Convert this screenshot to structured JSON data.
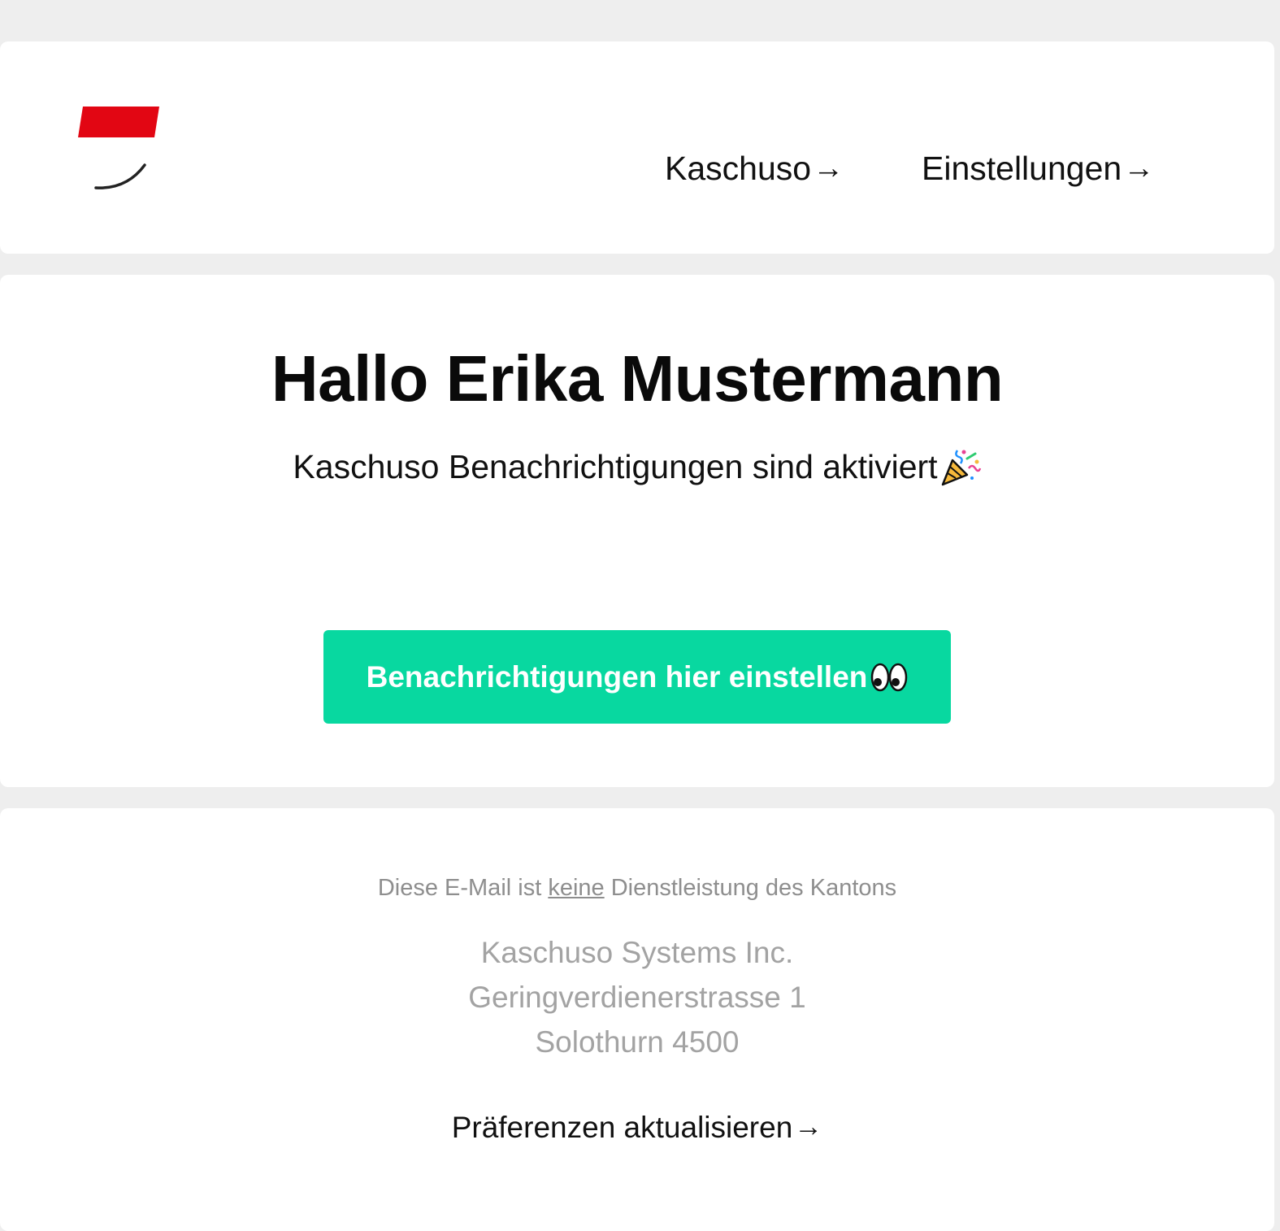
{
  "header": {
    "nav_kaschuso": "Kaschuso",
    "nav_einstellungen": "Einstellungen",
    "arrow": "→"
  },
  "main": {
    "title": "Hallo Erika Mustermann",
    "subtitle": "Kaschuso Benachrichtigungen sind aktiviert",
    "subtitle_icon": "party-popper-icon",
    "cta_label": "Benachrichtigungen hier einstellen",
    "cta_icon": "eyes-icon"
  },
  "footer": {
    "disclaimer_before": "Diese E-Mail ist ",
    "disclaimer_emphasis": "keine",
    "disclaimer_after": " Dienstleistung des Kantons",
    "address_line1": "Kaschuso Systems Inc.",
    "address_line2": "Geringverdienerstrasse 1",
    "address_line3": "Solothurn 4500",
    "prefs_link": "Präferenzen aktualisieren",
    "arrow": "→"
  },
  "colors": {
    "background": "#eeeeee",
    "card": "#ffffff",
    "cta": "#08d8a0",
    "logo_red": "#e20613",
    "footer_text": "#a3a3a3"
  }
}
